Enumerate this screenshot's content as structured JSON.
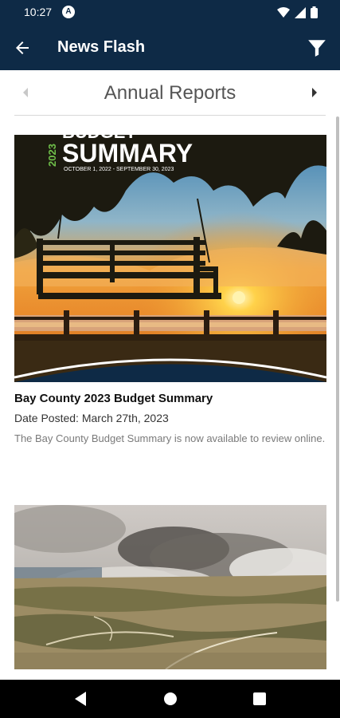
{
  "status_bar": {
    "time": "10:27",
    "a_badge": "A",
    "icons": [
      "wifi-icon",
      "signal-icon",
      "battery-icon"
    ]
  },
  "app_bar": {
    "title": "News Flash",
    "back_icon": "arrow-left-icon",
    "filter_icon": "filter-icon"
  },
  "category": {
    "label": "Annual Reports"
  },
  "cards": [
    {
      "cover_title": "SUMMARY",
      "cover_year": "2023",
      "cover_heading": "BUDGET",
      "cover_dates": "OCTOBER 1, 2022 - SEPTEMBER 30, 2023",
      "title": "Bay County 2023 Budget Summary",
      "date": "Date Posted: March 27th, 2023",
      "description": "The Bay County Budget Summary is now available to review online."
    }
  ],
  "colors": {
    "primary": "#0e2a46",
    "background": "#ffffff"
  }
}
